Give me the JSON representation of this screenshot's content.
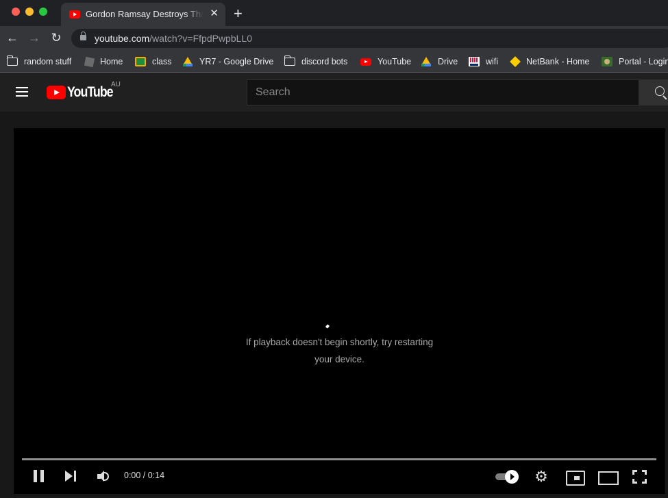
{
  "browser": {
    "tab": {
      "title": "Gordon Ramsay Destroys That Restaurant",
      "favicon": "youtube-icon"
    },
    "new_tab_label": "+",
    "close_tab_label": "✕",
    "nav": {
      "back": "←",
      "forward": "→",
      "reload": "↻"
    },
    "url": {
      "host": "youtube.com",
      "path": "/watch?v=FfpdPwpbLL0"
    },
    "bookmarks": [
      {
        "label": "random stuff",
        "icon": "folder-icon"
      },
      {
        "label": "Home",
        "icon": "roblox-icon"
      },
      {
        "label": "class",
        "icon": "google-classroom-icon"
      },
      {
        "label": "YR7 - Google Drive",
        "icon": "google-drive-icon"
      },
      {
        "label": "discord bots",
        "icon": "folder-icon"
      },
      {
        "label": "YouTube",
        "icon": "youtube-icon"
      },
      {
        "label": "Drive",
        "icon": "google-drive-icon"
      },
      {
        "label": "wifi",
        "icon": "nsw-icon"
      },
      {
        "label": "NetBank - Home",
        "icon": "netbank-icon"
      },
      {
        "label": "Portal - Login",
        "icon": "school-crest-icon"
      }
    ]
  },
  "youtube": {
    "logo_text": "YouTube",
    "country_code": "AU",
    "search": {
      "placeholder": "Search",
      "value": ""
    }
  },
  "player": {
    "message": "If playback doesn't begin shortly, try restarting your device.",
    "current_time": "0:00",
    "duration": "0:14",
    "time_display": "0:00 / 0:14",
    "progress_fraction": 0,
    "state": "playing",
    "autoplay": true,
    "settings_glyph": "⚙",
    "colors": {
      "progress_played": "#ff0000",
      "progress_track": "#8e8e8e"
    }
  }
}
